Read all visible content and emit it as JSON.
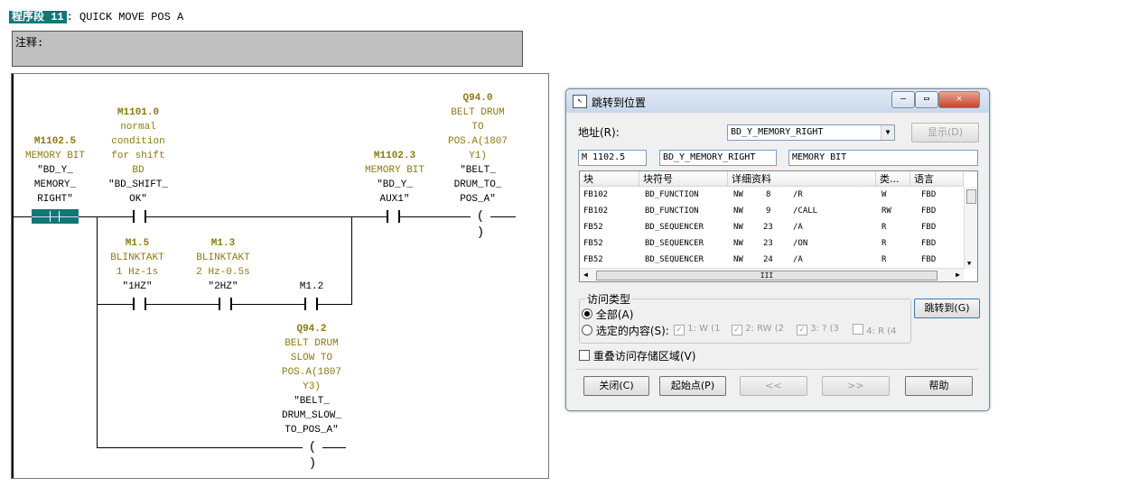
{
  "network": {
    "tag": "程序段 11",
    "sep": ":",
    "title": "QUICK MOVE POS A",
    "comment_label": "注释:"
  },
  "ladder": {
    "contacts": [
      {
        "addr": "M1102.5",
        "lines": [
          "MEMORY BIT",
          "\"BD_Y_",
          "MEMORY_",
          "RIGHT\""
        ]
      },
      {
        "addr": "M1101.0",
        "lines": [
          "normal",
          "condition",
          "for shift",
          "BD",
          "\"BD_SHIFT_",
          "OK\""
        ]
      },
      {
        "addr": "M1102.3",
        "lines": [
          "MEMORY BIT",
          "\"BD_Y_",
          "AUX1\""
        ]
      },
      {
        "addr": "M1.5",
        "lines": [
          "BLINKTAKT",
          "1 Hz-1s",
          "\"1HZ\""
        ]
      },
      {
        "addr": "M1.3",
        "lines": [
          "BLINKTAKT",
          "2 Hz-0.5s",
          "\"2HZ\""
        ]
      },
      {
        "addr": "",
        "lines": [
          "M1.2"
        ]
      }
    ],
    "coils": [
      {
        "addr": "Q94.0",
        "lines": [
          "BELT DRUM",
          "TO",
          "POS.A(1807",
          "Y1)",
          "\"BELT_",
          "DRUM_TO_",
          "POS_A\""
        ]
      },
      {
        "addr": "Q94.2",
        "lines": [
          "BELT DRUM",
          "SLOW TO",
          "POS.A(1807",
          "Y3)",
          "\"BELT_",
          "DRUM_SLOW_",
          "TO_POS_A\""
        ]
      }
    ]
  },
  "dialog": {
    "title": "跳转到位置",
    "address_label": "地址(R):",
    "address_value": "BD_Y_MEMORY_RIGHT",
    "show_button": "显示(D)",
    "info": [
      "M    1102.5",
      "BD_Y_MEMORY_RIGHT",
      "MEMORY BIT"
    ],
    "columns": [
      "块",
      "块符号",
      "详细资料",
      "类...",
      "语言"
    ],
    "rows": [
      [
        "FB102",
        "BD_FUNCTION",
        "NW",
        "8",
        "/R",
        "W",
        "FBD"
      ],
      [
        "FB102",
        "BD_FUNCTION",
        "NW",
        "9",
        "/CALL",
        "RW",
        "FBD"
      ],
      [
        "FB52",
        "BD_SEQUENCER",
        "NW",
        "23",
        "/A",
        "R",
        "FBD"
      ],
      [
        "FB52",
        "BD_SEQUENCER",
        "NW",
        "23",
        "/ON",
        "R",
        "FBD"
      ],
      [
        "FB52",
        "BD_SEQUENCER",
        "NW",
        "24",
        "/A",
        "R",
        "FBD"
      ]
    ],
    "scroll_grip": "III",
    "access_group": "访问类型",
    "radio_all": "全部(A)",
    "radio_selected": "选定的内容(S):",
    "checks": [
      "1: W (1",
      "2: RW (2",
      "3: ? (3",
      "4: R (4"
    ],
    "jump_button": "跳转到(G)",
    "overlap_label": "重叠访问存储区域(V)",
    "btn_close": "关闭(C)",
    "btn_origin": "起始点(P)",
    "btn_prev": "<<",
    "btn_next": ">>",
    "btn_help": "帮助"
  }
}
